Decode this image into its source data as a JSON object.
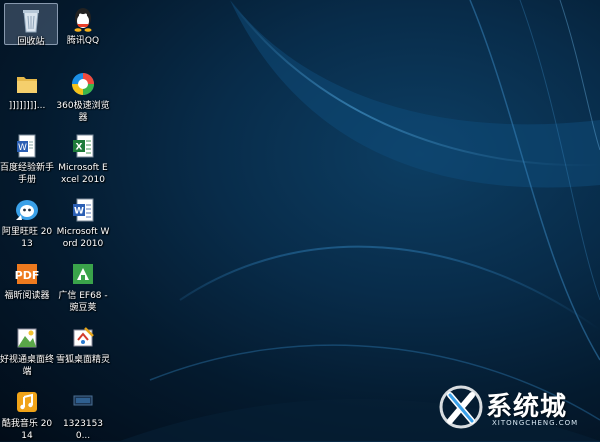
{
  "desktop": {
    "icons": [
      {
        "name": "recycle-bin-icon",
        "label": "回收站"
      },
      {
        "name": "qq-icon",
        "label": "腾讯QQ"
      },
      {
        "name": "folder-icon",
        "label": "]]]]]]]]..."
      },
      {
        "name": "browser-360-icon",
        "label": "360极速浏览器"
      },
      {
        "name": "document-icon",
        "label": "百度经验新手手册"
      },
      {
        "name": "excel-icon",
        "label": "Microsoft Excel 2010"
      },
      {
        "name": "aliwangwang-icon",
        "label": "阿里旺旺 2013"
      },
      {
        "name": "word-icon",
        "label": "Microsoft Word 2010"
      },
      {
        "name": "pdf-reader-icon",
        "label": "福昕阅读器"
      },
      {
        "name": "ef68-icon",
        "label": "广信 EF68 - 豌豆荚"
      },
      {
        "name": "desktop-app-icon",
        "label": "好视通桌面终端"
      },
      {
        "name": "desktop-sprite-icon",
        "label": "雪狐桌面精灵"
      },
      {
        "name": "music-icon",
        "label": "酷我音乐 2014"
      },
      {
        "name": "image-file-icon",
        "label": "13231530..."
      }
    ],
    "selected_icon": "回收站"
  },
  "watermark": {
    "logo_text": "系统城",
    "sub_text": "XITONGCHENG.COM"
  },
  "colors": {
    "selection": "#a0b4d2",
    "label": "#ffffff",
    "wallpaper_dark": "#041a2e",
    "wallpaper_glow": "#0d3e63"
  }
}
